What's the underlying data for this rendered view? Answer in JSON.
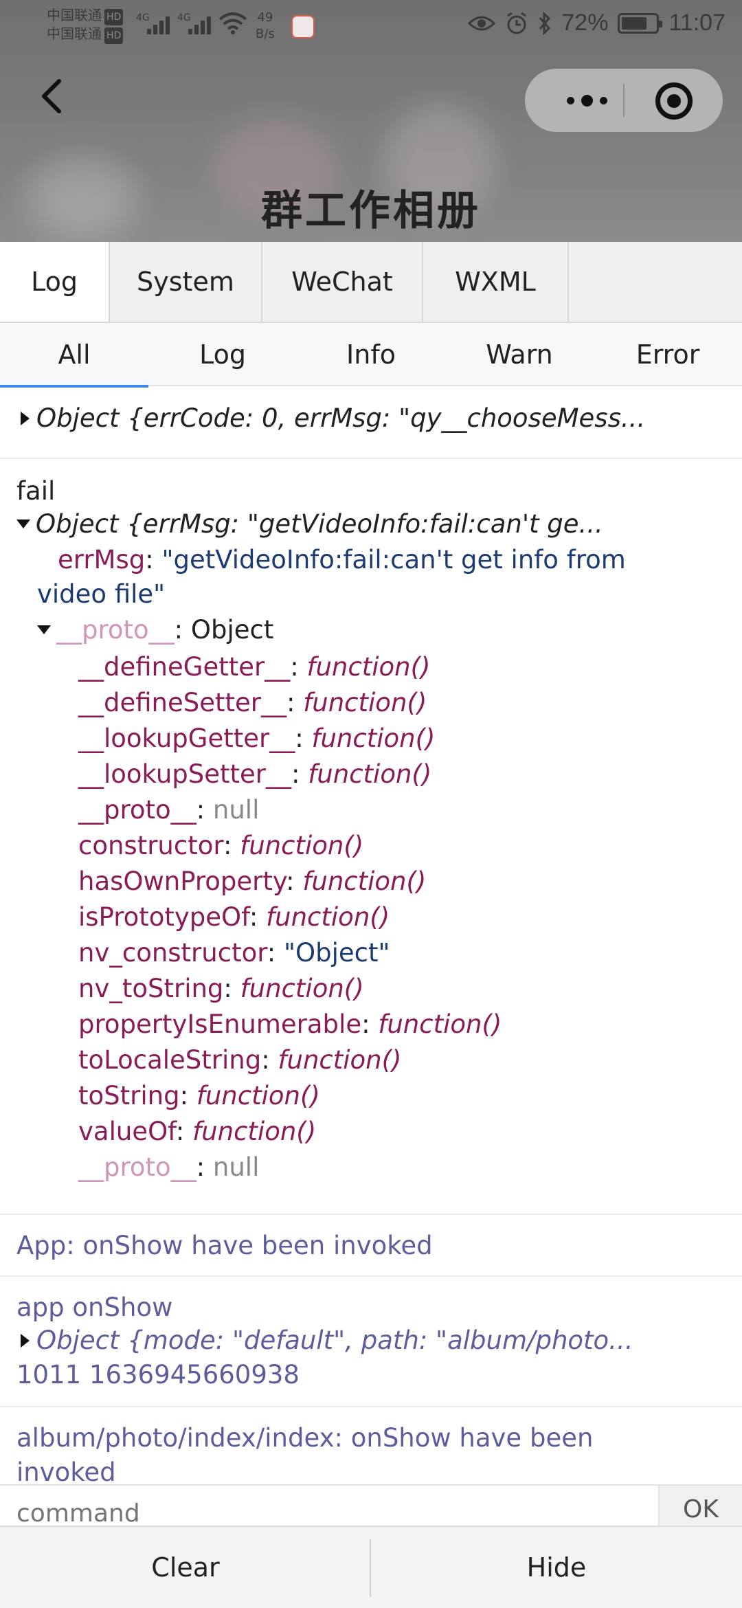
{
  "status_bar": {
    "carrier_1": "中国联通",
    "carrier_2": "中国联通",
    "hd_badge": "HD",
    "signal_1": "4G",
    "signal_2": "4G",
    "net_speed_value": "49",
    "net_speed_unit": "B/s",
    "battery": "72%",
    "time": "11:07"
  },
  "header": {
    "title": "群工作相册"
  },
  "top_tabs": [
    {
      "label": "Log",
      "active": true
    },
    {
      "label": "System",
      "active": false
    },
    {
      "label": "WeChat",
      "active": false
    },
    {
      "label": "WXML",
      "active": false
    }
  ],
  "filter_tabs": [
    {
      "label": "All",
      "active": true
    },
    {
      "label": "Log",
      "active": false
    },
    {
      "label": "Info",
      "active": false
    },
    {
      "label": "Warn",
      "active": false
    },
    {
      "label": "Error",
      "active": false
    }
  ],
  "logs": {
    "entry1": {
      "summary": "Object {errCode: 0, errMsg: \"qy__chooseMess..."
    },
    "entry2": {
      "label": "fail",
      "summary": "Object {errMsg: \"getVideoInfo:fail:can't ge...",
      "errmsg_key": "errMsg",
      "errmsg_value_1": "\"getVideoInfo:fail:can't get info from",
      "errmsg_value_2": "video file\"",
      "proto_key": "__proto__",
      "proto_value": "Object",
      "props": [
        {
          "key": "__defineGetter__",
          "value": "function()"
        },
        {
          "key": "__defineSetter__",
          "value": "function()"
        },
        {
          "key": "__lookupGetter__",
          "value": "function()"
        },
        {
          "key": "__lookupSetter__",
          "value": "function()"
        },
        {
          "key": "__proto__",
          "value": "null"
        },
        {
          "key": "constructor",
          "value": "function()"
        },
        {
          "key": "hasOwnProperty",
          "value": "function()"
        },
        {
          "key": "isPrototypeOf",
          "value": "function()"
        },
        {
          "key": "nv_constructor",
          "value": "\"Object\""
        },
        {
          "key": "nv_toString",
          "value": "function()"
        },
        {
          "key": "propertyIsEnumerable",
          "value": "function()"
        },
        {
          "key": "toLocaleString",
          "value": "function()"
        },
        {
          "key": "toString",
          "value": "function()"
        },
        {
          "key": "valueOf",
          "value": "function()"
        },
        {
          "key": "__proto__",
          "value": "null"
        }
      ]
    },
    "entry3": {
      "text": "App: onShow have been invoked"
    },
    "entry4": {
      "text": "app onShow",
      "summary": "Object {mode: \"default\", path: \"album/photo...",
      "extra": "1011 1636945660938"
    },
    "entry5": {
      "text_1": "album/photo/index/index: onShow have been",
      "text_2": "invoked"
    }
  },
  "command": {
    "placeholder": "command",
    "ok_label": "OK"
  },
  "bottom": {
    "clear_label": "Clear",
    "hide_label": "Hide"
  }
}
